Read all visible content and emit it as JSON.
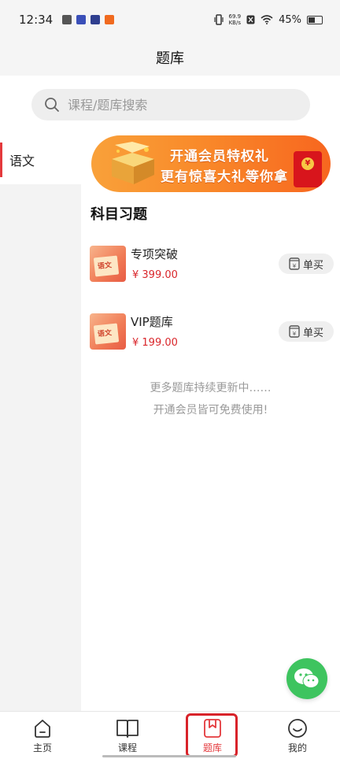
{
  "status_bar": {
    "time": "12:34",
    "net_speed_value": "69.9",
    "net_speed_unit": "KB/s",
    "battery": "45%"
  },
  "header": {
    "title": "题库"
  },
  "search": {
    "placeholder": "课程/题库搜索",
    "icon": "search-icon"
  },
  "sidebar": {
    "items": [
      {
        "label": "语文",
        "active": true
      }
    ]
  },
  "banner": {
    "line1": "开通会员特权礼",
    "line2": "更有惊喜大礼等你拿"
  },
  "section": {
    "title": "科目习题"
  },
  "products": [
    {
      "name": "专项突破",
      "price": "¥ 399.00",
      "buy_label": "单买",
      "thumb_text": "语文"
    },
    {
      "name": "VIP题库",
      "price": "¥ 199.00",
      "buy_label": "单买",
      "thumb_text": "语文"
    }
  ],
  "footer_note": {
    "line1": "更多题库持续更新中……",
    "line2": "开通会员皆可免费使用!"
  },
  "bottom_nav": {
    "items": [
      {
        "label": "主页",
        "icon": "home-icon"
      },
      {
        "label": "课程",
        "icon": "book-icon"
      },
      {
        "label": "题库",
        "icon": "bookmark-icon",
        "active": true
      },
      {
        "label": "我的",
        "icon": "smile-icon"
      }
    ]
  },
  "colors": {
    "accent": "#e4393c",
    "price": "#d9262b",
    "wechat": "#3ec45f",
    "banner": "#f98a2a"
  }
}
